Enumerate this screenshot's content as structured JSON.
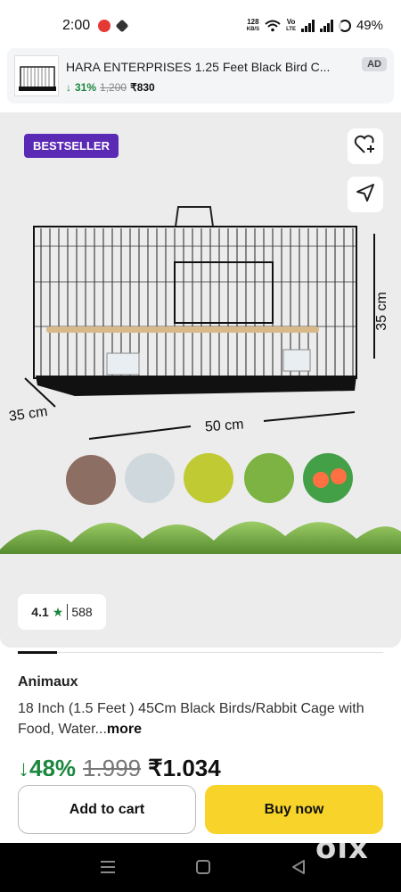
{
  "status_bar": {
    "time": "2:00",
    "net_speed_value": "128",
    "net_speed_unit": "KB/S",
    "network_label_1": "Vo",
    "network_label_2": "LTE",
    "battery": "49%"
  },
  "ad_banner": {
    "title": "HARA ENTERPRISES 1.25 Feet Black Bird C...",
    "discount": "31%",
    "mrp": "1,200",
    "price": "₹830",
    "tag": "AD"
  },
  "hero": {
    "badge": "BESTSELLER",
    "dim_height": "35 cm",
    "dim_depth": "35 cm",
    "dim_width": "50 cm",
    "wishlist_icon": "heart-plus-icon",
    "share_icon": "send-icon"
  },
  "rating": {
    "value": "4.1",
    "count": "588"
  },
  "product": {
    "brand": "Animaux",
    "title": "18 Inch (1.5 Feet ) 45Cm Black Birds/Rabbit Cage with Food, Water...",
    "more_label": "more",
    "discount": "48%",
    "mrp": "1,999",
    "price": "₹1,034"
  },
  "actions": {
    "add_to_cart": "Add to cart",
    "buy_now": "Buy now"
  },
  "nav": {
    "watermark": "olx"
  },
  "colors": {
    "badge_purple": "#5b2ab5",
    "discount_green": "#1b873f",
    "buy_yellow": "#f8d42a"
  }
}
